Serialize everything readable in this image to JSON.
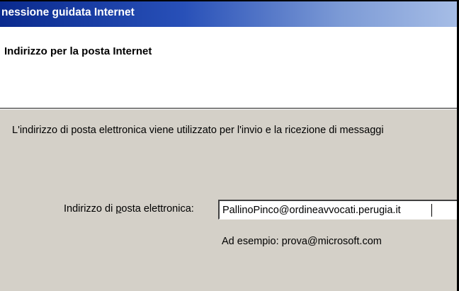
{
  "window": {
    "title": "nessione guidata Internet"
  },
  "header": {
    "title": "Indirizzo per la posta Internet"
  },
  "content": {
    "description": "L'indirizzo di posta elettronica viene utilizzato per l'invio e la ricezione di messaggi",
    "email_label_prefix": "Indirizzo di ",
    "email_label_accel": "p",
    "email_label_suffix": "osta elettronica:",
    "email_value": "PallinoPinco@ordineavvocati.perugia.it",
    "example_text": "Ad esempio: prova@microsoft.com"
  },
  "colors": {
    "dialog_background": "#d4d0c8",
    "titlebar_start": "#0a2a8e",
    "titlebar_end": "#a6bde6"
  }
}
